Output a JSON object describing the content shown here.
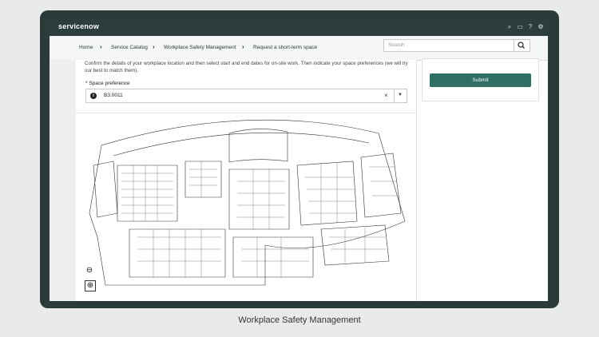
{
  "app": {
    "brand": "servicenow"
  },
  "topbar": {
    "icons": [
      "search-icon",
      "chat-icon",
      "help-icon",
      "settings-icon"
    ]
  },
  "breadcrumb": {
    "items": [
      "Home",
      "Service Catalog",
      "Workplace Safety Management",
      "Request a short-term space"
    ]
  },
  "search": {
    "placeholder": "Search"
  },
  "form": {
    "instructions": "Confirm the details of your workplace location and then select start and end dates for on-site work. Then indicate your space preferences (we will try our best to match them).",
    "required_marker": "*",
    "space_label": "Space preference",
    "space_value": "B3.0011"
  },
  "actions": {
    "submit": "Submit"
  },
  "map": {
    "zoom_icons": [
      "zoom-out-icon",
      "zoom-in-icon"
    ]
  },
  "caption": "Workplace Safety Management",
  "colors": {
    "frame": "#2a3b3a",
    "topbar": "#2b3d3c",
    "accent": "#2f6e62"
  }
}
